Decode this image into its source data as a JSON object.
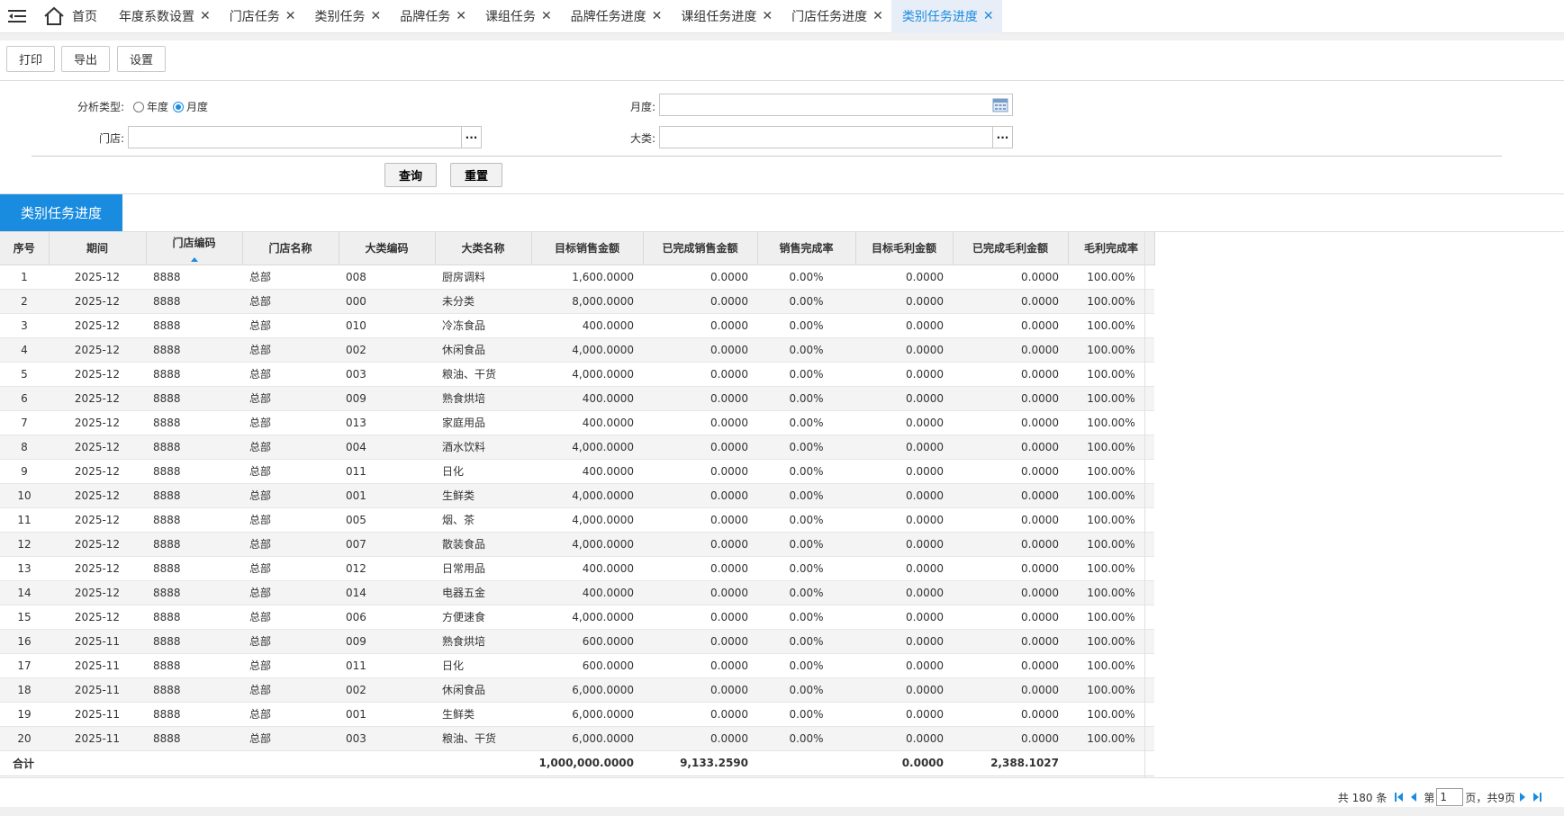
{
  "tabs": {
    "home_label": "首页",
    "items": [
      {
        "label": "年度系数设置"
      },
      {
        "label": "门店任务"
      },
      {
        "label": "类别任务"
      },
      {
        "label": "品牌任务"
      },
      {
        "label": "课组任务"
      },
      {
        "label": "品牌任务进度"
      },
      {
        "label": "课组任务进度"
      },
      {
        "label": "门店任务进度"
      },
      {
        "label": "类别任务进度",
        "active": true
      }
    ],
    "close_glyph": "✕"
  },
  "toolbar": {
    "print": "打印",
    "export": "导出",
    "settings": "设置"
  },
  "form": {
    "analysis_type_label": "分析类型:",
    "opt_year": "年度",
    "opt_month": "月度",
    "selected": "月度",
    "month_label": "月度:",
    "month_value": "",
    "store_label": "门店:",
    "store_value": "",
    "category_label": "大类:",
    "category_value": "",
    "query_btn": "查询",
    "reset_btn": "重置",
    "dots": "···"
  },
  "section_title": "类别任务进度",
  "grid": {
    "columns": [
      "序号",
      "期间",
      "门店编码",
      "门店名称",
      "大类编码",
      "大类名称",
      "目标销售金额",
      "已完成销售金额",
      "销售完成率",
      "目标毛利金额",
      "已完成毛利金额",
      "毛利完成率"
    ],
    "rows": [
      [
        "1",
        "2025-12",
        "8888",
        "总部",
        "008",
        "厨房调料",
        "1,600.0000",
        "0.0000",
        "0.00%",
        "0.0000",
        "0.0000",
        "100.00%"
      ],
      [
        "2",
        "2025-12",
        "8888",
        "总部",
        "000",
        "未分类",
        "8,000.0000",
        "0.0000",
        "0.00%",
        "0.0000",
        "0.0000",
        "100.00%"
      ],
      [
        "3",
        "2025-12",
        "8888",
        "总部",
        "010",
        "冷冻食品",
        "400.0000",
        "0.0000",
        "0.00%",
        "0.0000",
        "0.0000",
        "100.00%"
      ],
      [
        "4",
        "2025-12",
        "8888",
        "总部",
        "002",
        "休闲食品",
        "4,000.0000",
        "0.0000",
        "0.00%",
        "0.0000",
        "0.0000",
        "100.00%"
      ],
      [
        "5",
        "2025-12",
        "8888",
        "总部",
        "003",
        "粮油、干货",
        "4,000.0000",
        "0.0000",
        "0.00%",
        "0.0000",
        "0.0000",
        "100.00%"
      ],
      [
        "6",
        "2025-12",
        "8888",
        "总部",
        "009",
        "熟食烘培",
        "400.0000",
        "0.0000",
        "0.00%",
        "0.0000",
        "0.0000",
        "100.00%"
      ],
      [
        "7",
        "2025-12",
        "8888",
        "总部",
        "013",
        "家庭用品",
        "400.0000",
        "0.0000",
        "0.00%",
        "0.0000",
        "0.0000",
        "100.00%"
      ],
      [
        "8",
        "2025-12",
        "8888",
        "总部",
        "004",
        "酒水饮料",
        "4,000.0000",
        "0.0000",
        "0.00%",
        "0.0000",
        "0.0000",
        "100.00%"
      ],
      [
        "9",
        "2025-12",
        "8888",
        "总部",
        "011",
        "日化",
        "400.0000",
        "0.0000",
        "0.00%",
        "0.0000",
        "0.0000",
        "100.00%"
      ],
      [
        "10",
        "2025-12",
        "8888",
        "总部",
        "001",
        "生鲜类",
        "4,000.0000",
        "0.0000",
        "0.00%",
        "0.0000",
        "0.0000",
        "100.00%"
      ],
      [
        "11",
        "2025-12",
        "8888",
        "总部",
        "005",
        "烟、茶",
        "4,000.0000",
        "0.0000",
        "0.00%",
        "0.0000",
        "0.0000",
        "100.00%"
      ],
      [
        "12",
        "2025-12",
        "8888",
        "总部",
        "007",
        "散装食品",
        "4,000.0000",
        "0.0000",
        "0.00%",
        "0.0000",
        "0.0000",
        "100.00%"
      ],
      [
        "13",
        "2025-12",
        "8888",
        "总部",
        "012",
        "日常用品",
        "400.0000",
        "0.0000",
        "0.00%",
        "0.0000",
        "0.0000",
        "100.00%"
      ],
      [
        "14",
        "2025-12",
        "8888",
        "总部",
        "014",
        "电器五金",
        "400.0000",
        "0.0000",
        "0.00%",
        "0.0000",
        "0.0000",
        "100.00%"
      ],
      [
        "15",
        "2025-12",
        "8888",
        "总部",
        "006",
        "方便速食",
        "4,000.0000",
        "0.0000",
        "0.00%",
        "0.0000",
        "0.0000",
        "100.00%"
      ],
      [
        "16",
        "2025-11",
        "8888",
        "总部",
        "009",
        "熟食烘培",
        "600.0000",
        "0.0000",
        "0.00%",
        "0.0000",
        "0.0000",
        "100.00%"
      ],
      [
        "17",
        "2025-11",
        "8888",
        "总部",
        "011",
        "日化",
        "600.0000",
        "0.0000",
        "0.00%",
        "0.0000",
        "0.0000",
        "100.00%"
      ],
      [
        "18",
        "2025-11",
        "8888",
        "总部",
        "002",
        "休闲食品",
        "6,000.0000",
        "0.0000",
        "0.00%",
        "0.0000",
        "0.0000",
        "100.00%"
      ],
      [
        "19",
        "2025-11",
        "8888",
        "总部",
        "001",
        "生鲜类",
        "6,000.0000",
        "0.0000",
        "0.00%",
        "0.0000",
        "0.0000",
        "100.00%"
      ],
      [
        "20",
        "2025-11",
        "8888",
        "总部",
        "003",
        "粮油、干货",
        "6,000.0000",
        "0.0000",
        "0.00%",
        "0.0000",
        "0.0000",
        "100.00%"
      ]
    ],
    "total": {
      "label": "合计",
      "target_sales": "1,000,000.0000",
      "done_sales": "9,133.2590",
      "target_profit": "0.0000",
      "done_profit": "2,388.1027"
    }
  },
  "pager": {
    "total_text": "共 180 条",
    "page_prefix": "第",
    "page_value": "1",
    "page_suffix": "页，共9页"
  },
  "colors": {
    "accent": "#1a8ce0"
  }
}
